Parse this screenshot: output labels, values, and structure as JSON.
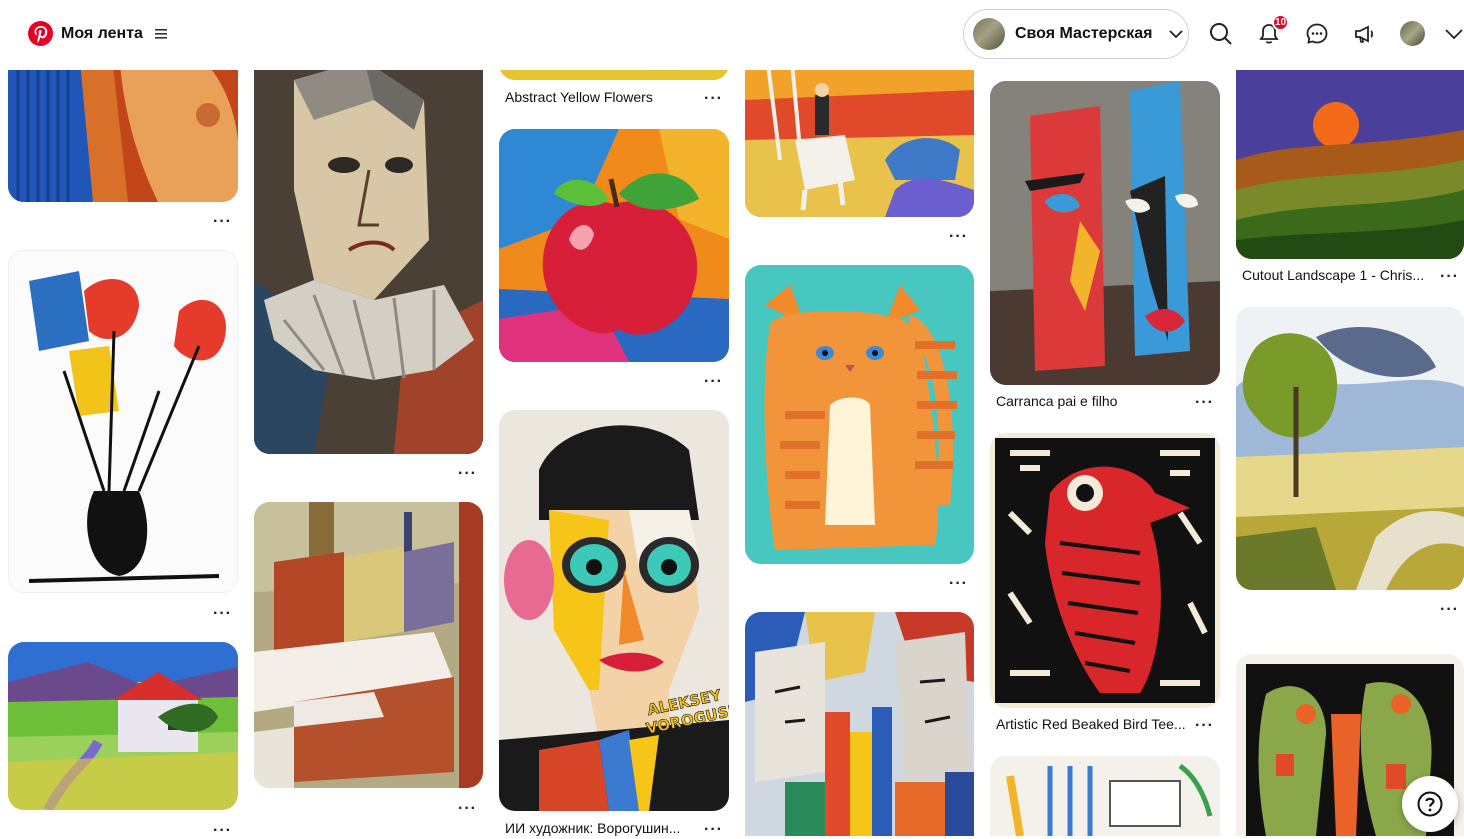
{
  "header": {
    "brand_label": "Моя лента",
    "workspace_label": "Своя Мастерская",
    "notifications_count": "10"
  },
  "pins": {
    "p3_title": "Abstract Yellow Flowers",
    "p11_title": "Carranca pai e filho",
    "p12_title": "Artistic Red Beaked Bird Tee...",
    "p14_title": "Cutout Landscape 1 - Chris...",
    "p7_title": "ИИ художник: Ворогушин...",
    "signature_text": "ALEKSEY VOROGUSHIN"
  },
  "colors": {
    "brand_red": "#e60023"
  }
}
